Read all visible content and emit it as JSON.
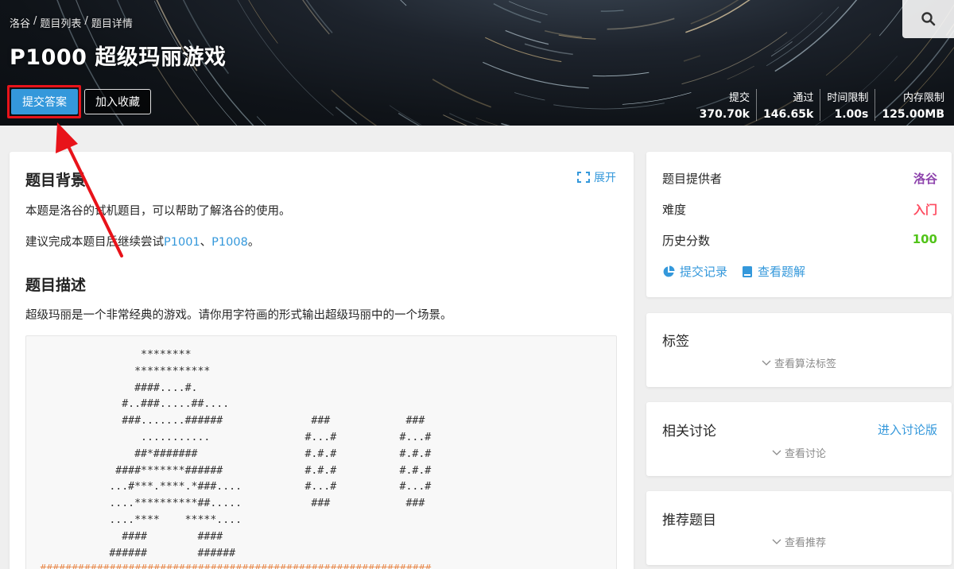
{
  "header": {
    "breadcrumb": [
      "洛谷",
      "/",
      "题目列表",
      "/",
      "题目详情"
    ],
    "title": "P1000 超级玛丽游戏",
    "submit_label": "提交答案",
    "favorite_label": "加入收藏",
    "stats": [
      {
        "label": "提交",
        "value": "370.70k"
      },
      {
        "label": "通过",
        "value": "146.65k"
      },
      {
        "label": "时间限制",
        "value": "1.00s"
      },
      {
        "label": "内存限制",
        "value": "125.00MB"
      }
    ]
  },
  "main": {
    "background_heading": "题目背景",
    "expand_label": "展开",
    "background_text": "本题是洛谷的试机题目，可以帮助了解洛谷的使用。",
    "suggest_prefix": "建议完成本题目后继续尝试",
    "suggest_link1": "P1001",
    "suggest_sep": "、",
    "suggest_link2": "P1008",
    "suggest_suffix": "。",
    "description_heading": "题目描述",
    "description_text": "超级玛丽是一个非常经典的游戏。请你用字符画的形式输出超级玛丽中的一个场景。",
    "ascii_art": "                ********\n               ************\n               ####....#.\n             #..###.....##....\n             ###.......######              ###            ###\n                ...........               #...#          #...#\n               ##*#######                 #.#.#          #.#.#\n            ####*******######             #.#.#          #.#.#\n           ...#***.****.*###....          #...#          #...#\n           ....**********##.....           ###            ###\n           ....****    *****....\n             ####        ####\n           ######        ######",
    "ascii_ground": "##############################################################"
  },
  "sidebar": {
    "info": [
      {
        "label": "题目提供者",
        "value": "洛谷",
        "color": "#8e44ad"
      },
      {
        "label": "难度",
        "value": "入门",
        "color": "#fe4c61"
      },
      {
        "label": "历史分数",
        "value": "100",
        "color": "#52c41a"
      }
    ],
    "submit_records": "提交记录",
    "view_solution": "查看题解",
    "tags_title": "标签",
    "tags_more": "查看算法标签",
    "discuss_title": "相关讨论",
    "discuss_action": "进入讨论版",
    "discuss_more": "查看讨论",
    "recommend_title": "推荐题目",
    "recommend_more": "查看推荐"
  },
  "colors": {
    "accent": "#3498db",
    "annotation": "#e8131a"
  }
}
